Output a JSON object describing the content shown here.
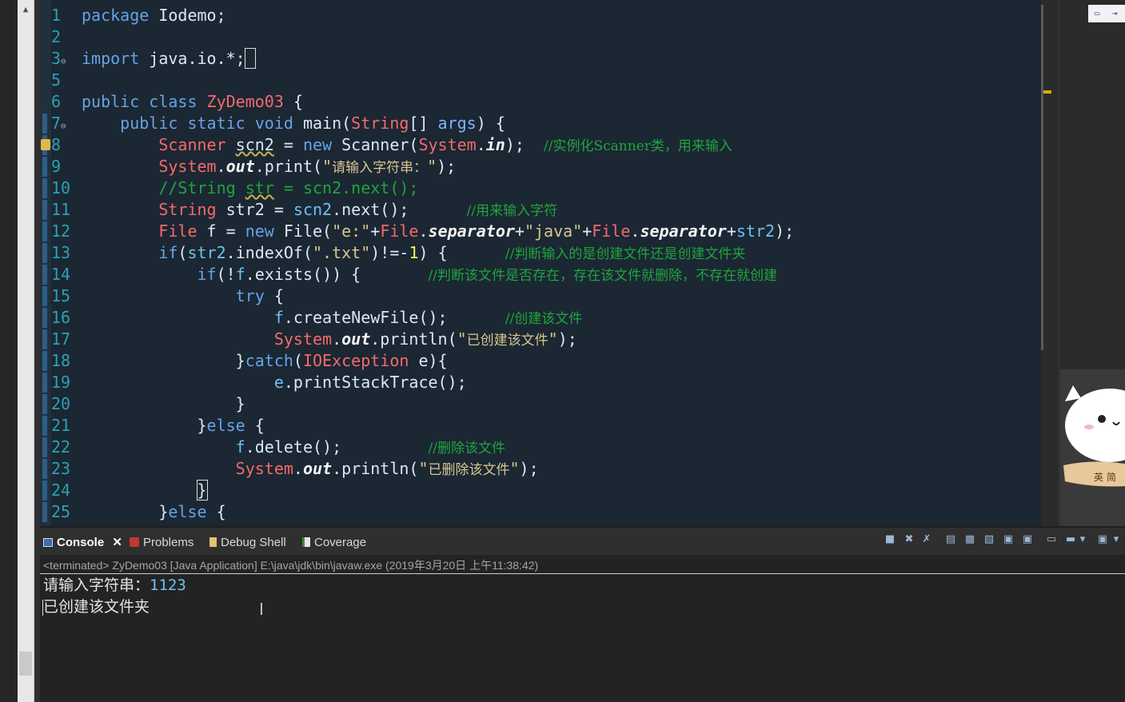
{
  "editor": {
    "lines": [
      {
        "n": "1",
        "html": "<span class=\"kw\">package</span> Iodemo;"
      },
      {
        "n": "2",
        "html": ""
      },
      {
        "n": "3",
        "fold": true,
        "html": "<span class=\"kw\">import</span> java.io.*;<span class=\"box\">&nbsp;</span>"
      },
      {
        "n": "5",
        "html": ""
      },
      {
        "n": "6",
        "html": "<span class=\"kw\">public class</span> <span class=\"ty\">ZyDemo03</span> {"
      },
      {
        "n": "7",
        "fold": true,
        "mark": true,
        "html": "    <span class=\"kw\">public static void</span> main(<span class=\"ty\">String</span>[] <span class=\"par\">args</span>) {"
      },
      {
        "n": "8",
        "mark": true,
        "warn": true,
        "html": "        <span class=\"ty\">Scanner</span> <span class=\"ul\">scn2</span> = <span class=\"kw\">new</span> Scanner(<span class=\"ty\">System</span>.<span class=\"fld\">in</span>);  <span class=\"cm\">//实例化Scanner类，用来输入</span>"
      },
      {
        "n": "9",
        "mark": true,
        "html": "        <span class=\"ty\">System</span>.<span class=\"fld\">out</span>.print(<span class=\"str\">\"</span><span class=\"cm\" style=\"color:#d8c68f\">请输入字符串：</span><span class=\"str\">\"</span>);"
      },
      {
        "n": "10",
        "mark": true,
        "html": "        <span class=\"cm\" style=\"font-family:'DejaVu Sans Mono',monospace;font-size:20px\">//String <span class=\"ul\">str</span> = scn2.next();</span>"
      },
      {
        "n": "11",
        "mark": true,
        "html": "        <span class=\"ty\">String</span> str2 = <span class=\"var\">scn2</span>.next();      <span class=\"cm\">//用来输入字符</span>"
      },
      {
        "n": "12",
        "mark": true,
        "html": "        <span class=\"ty\">File</span> f = <span class=\"kw\">new</span> File(<span class=\"str\">\"e:\"</span>+<span class=\"ty\">File</span>.<span class=\"fld\">separator</span>+<span class=\"str\">\"java\"</span>+<span class=\"ty\">File</span>.<span class=\"fld\">separator</span>+<span class=\"var\">str2</span>);"
      },
      {
        "n": "13",
        "mark": true,
        "html": "        <span class=\"kw\">if</span>(<span class=\"var\">str2</span>.indexOf(<span class=\"str\">\".txt\"</span>)!=-<span class=\"num\">1</span>) {      <span class=\"cm\">//判断输入的是创建文件还是创建文件夹</span>"
      },
      {
        "n": "14",
        "mark": true,
        "html": "            <span class=\"kw\">if</span>(!<span class=\"var\">f</span>.exists()) {       <span class=\"cm\">//判断该文件是否存在，存在该文件就删除，不存在就创建</span>"
      },
      {
        "n": "15",
        "mark": true,
        "html": "                <span class=\"kw\">try</span> {"
      },
      {
        "n": "16",
        "mark": true,
        "html": "                    <span class=\"var\">f</span>.createNewFile();      <span class=\"cm\">//创建该文件</span>"
      },
      {
        "n": "17",
        "mark": true,
        "html": "                    <span class=\"ty\">System</span>.<span class=\"fld\">out</span>.println(<span class=\"str\">\"</span><span class=\"cm\" style=\"color:#d8c68f\">已创建该文件</span><span class=\"str\">\"</span>);"
      },
      {
        "n": "18",
        "mark": true,
        "html": "                }<span class=\"kw\">catch</span>(<span class=\"ty\">IOException</span> e){"
      },
      {
        "n": "19",
        "mark": true,
        "html": "                    <span class=\"var\">e</span>.printStackTrace();"
      },
      {
        "n": "20",
        "mark": true,
        "html": "                }"
      },
      {
        "n": "21",
        "mark": true,
        "html": "            }<span class=\"kw\">else</span> {"
      },
      {
        "n": "22",
        "mark": true,
        "html": "                <span class=\"var\">f</span>.delete();         <span class=\"cm\">//删除该文件</span>"
      },
      {
        "n": "23",
        "mark": true,
        "html": "                <span class=\"ty\">System</span>.<span class=\"fld\">out</span>.println(<span class=\"str\">\"</span><span class=\"cm\" style=\"color:#d8c68f\">已删除该文件</span><span class=\"str\">\"</span>);"
      },
      {
        "n": "24",
        "mark": true,
        "html": "            <span class=\"box\">}</span>"
      },
      {
        "n": "25",
        "mark": true,
        "html": "        }<span class=\"kw\">else</span> {"
      }
    ]
  },
  "console": {
    "tabs": {
      "console": "Console",
      "problems": "Problems",
      "debug_shell": "Debug Shell",
      "coverage": "Coverage"
    },
    "description": "<terminated> ZyDemo03 [Java Application] E:\\java\\jdk\\bin\\javaw.exe (2019年3月20日 上午11:38:42)",
    "output": {
      "prompt": "请输入字符串：",
      "input": "1123",
      "result": "已创建该文件夹"
    }
  },
  "colors": {
    "editor_bg": "#1b2733",
    "keyword": "#66a3e6",
    "type": "#f46a6a",
    "comment": "#1fa53c",
    "line_number": "#2aa1b3"
  }
}
